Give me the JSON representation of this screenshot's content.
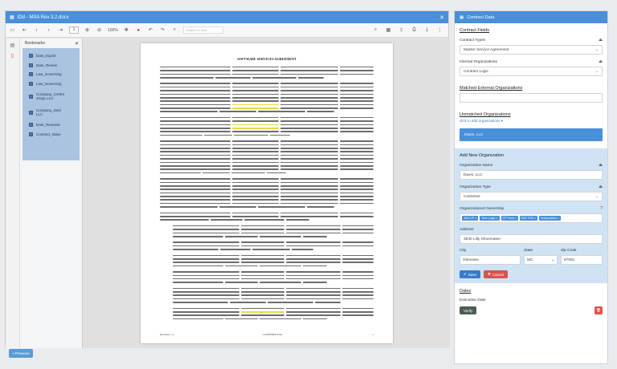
{
  "viewer": {
    "title": "IDd - MSA Rev 3.2.docx",
    "close_glyph": "✕",
    "toolbar": {
      "page_current": "1",
      "zoom": "100%",
      "search_placeholder": "Search in Text"
    },
    "bookmarks": {
      "title": "Bookmarks",
      "items": [
        "Date_Expire",
        "Date_Renew",
        "Law_Governing",
        "Law_Governing",
        "Company_Contra ctingL.LLC",
        "Company_Dani LLC",
        "Date_Renewal",
        "Contract_Value"
      ]
    },
    "document": {
      "title": "SOFTWARE SERVICES AGREEMENT",
      "footer_left": "Revision 1.2",
      "footer_center": "CONFIDENTIAL",
      "footer_right": "1"
    },
    "prev_label": "« Previous"
  },
  "contract": {
    "header": "Contract Data",
    "fields_title": "Contract Fields",
    "contract_types_label": "Contract Types",
    "contract_types_value": "Master Service Agreement",
    "internal_orgs_label": "Internal Organizations",
    "internal_orgs_value": "Contract Logic",
    "matched_title": "Matched External Organizations",
    "unmatched_title": "Unmatched Organizations",
    "unmatched_link": "click to add organizations ▾",
    "unmatched_item": "Davis, LLC",
    "add_org": {
      "title": "Add New Organization",
      "name_label": "Organization Name",
      "name_value": "Davis, LLC",
      "type_label": "Organization Type",
      "type_value": "Customer",
      "ownership_label": "Organizational Ownership",
      "ownership_tags": [
        "TAG-CF ×",
        "Tech Logic ×",
        "CF Fund ×",
        "ENT CPA ×",
        "Composition ×"
      ],
      "address_label": "Address",
      "address_value": "3640 Lilly Shoemaker",
      "city_label": "City",
      "city_value": "Glenview",
      "state_label": "State",
      "state_value": "MC",
      "zip_label": "Zip Code",
      "zip_value": "87091",
      "save_label": "Save",
      "cancel_label": "Cancel"
    },
    "dates_title": "Dates",
    "execution_label": "Execution Date",
    "verify_label": "Verify"
  }
}
